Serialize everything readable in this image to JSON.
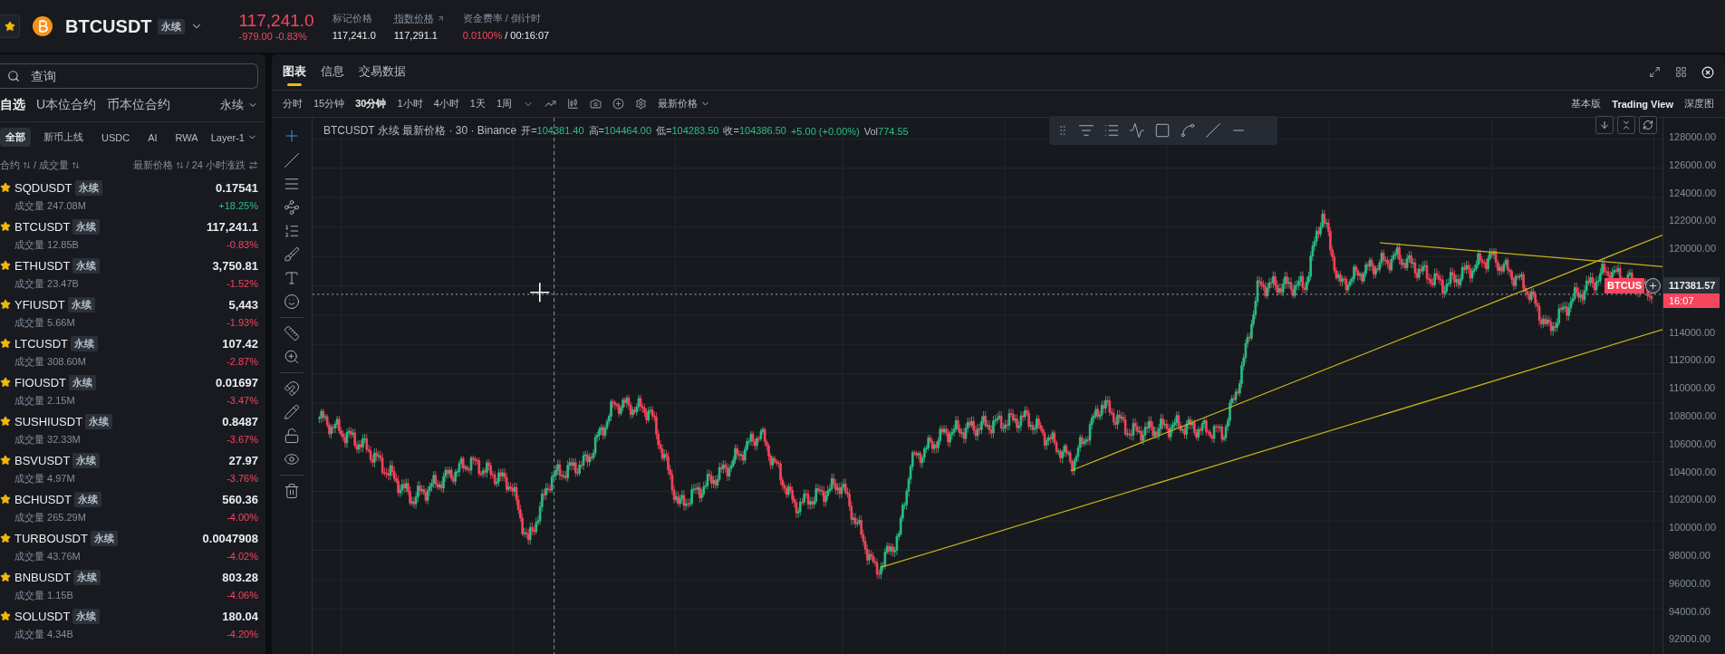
{
  "header": {
    "symbol": "BTCUSDT",
    "contract_tag": "永续",
    "starred": true,
    "price": "117,241.0",
    "change": "-979.00 -0.83%",
    "rising": false,
    "stats": [
      {
        "label": "标记价格",
        "value": "117,241.0",
        "link": false
      },
      {
        "label": "指数价格",
        "value": "117,291.1",
        "link": true
      }
    ],
    "funding": {
      "label": "资金费率 / 倒计时",
      "rate": "0.0100%",
      "countdown": "/ 00:16:07"
    }
  },
  "sidebar": {
    "search": {
      "placeholder": "查询"
    },
    "market_tabs": [
      {
        "label": "自选",
        "selected": true
      },
      {
        "label": "U本位合约",
        "selected": false
      },
      {
        "label": "币本位合约",
        "selected": false
      }
    ],
    "market_dropdown": "永续",
    "filters": [
      {
        "label": "全部",
        "selected": true
      },
      {
        "label": "新币上线",
        "selected": false
      },
      {
        "label": "USDC",
        "selected": false
      },
      {
        "label": "AI",
        "selected": false
      },
      {
        "label": "RWA",
        "selected": false
      }
    ],
    "filter_dropdown": "Layer-1",
    "columns": [
      {
        "label": "合约",
        "sub": "/ 成交量"
      },
      {
        "label": "最新价格",
        "sub": "/ 24 小时涨跌"
      }
    ],
    "rows": [
      {
        "symbol": "SQDUSDT",
        "tag": "永续",
        "starred": true,
        "price": "0.17541",
        "volume_label": "成交量",
        "volume": "247.08M",
        "change": "+18.25%",
        "rising": true
      },
      {
        "symbol": "BTCUSDT",
        "tag": "永续",
        "starred": true,
        "price": "117,241.1",
        "volume_label": "成交量",
        "volume": "12.85B",
        "change": "-0.83%",
        "rising": false
      },
      {
        "symbol": "ETHUSDT",
        "tag": "永续",
        "starred": true,
        "price": "3,750.81",
        "volume_label": "成交量",
        "volume": "23.47B",
        "change": "-1.52%",
        "rising": false
      },
      {
        "symbol": "YFIUSDT",
        "tag": "永续",
        "starred": true,
        "price": "5,443",
        "volume_label": "成交量",
        "volume": "5.66M",
        "change": "-1.93%",
        "rising": false
      },
      {
        "symbol": "LTCUSDT",
        "tag": "永续",
        "starred": true,
        "price": "107.42",
        "volume_label": "成交量",
        "volume": "308.60M",
        "change": "-2.87%",
        "rising": false
      },
      {
        "symbol": "FIOUSDT",
        "tag": "永续",
        "starred": true,
        "price": "0.01697",
        "volume_label": "成交量",
        "volume": "2.15M",
        "change": "-3.47%",
        "rising": false
      },
      {
        "symbol": "SUSHIUSDT",
        "tag": "永续",
        "starred": true,
        "price": "0.8487",
        "volume_label": "成交量",
        "volume": "32.33M",
        "change": "-3.67%",
        "rising": false
      },
      {
        "symbol": "BSVUSDT",
        "tag": "永续",
        "starred": true,
        "price": "27.97",
        "volume_label": "成交量",
        "volume": "4.97M",
        "change": "-3.76%",
        "rising": false
      },
      {
        "symbol": "BCHUSDT",
        "tag": "永续",
        "starred": true,
        "price": "560.36",
        "volume_label": "成交量",
        "volume": "265.29M",
        "change": "-4.00%",
        "rising": false
      },
      {
        "symbol": "TURBOUSDT",
        "tag": "永续",
        "starred": true,
        "price": "0.0047908",
        "volume_label": "成交量",
        "volume": "43.76M",
        "change": "-4.02%",
        "rising": false
      },
      {
        "symbol": "BNBUSDT",
        "tag": "永续",
        "starred": true,
        "price": "803.28",
        "volume_label": "成交量",
        "volume": "1.15B",
        "change": "-4.06%",
        "rising": false
      },
      {
        "symbol": "SOLUSDT",
        "tag": "永续",
        "starred": true,
        "price": "180.04",
        "volume_label": "成交量",
        "volume": "4.34B",
        "change": "-4.20%",
        "rising": false
      }
    ]
  },
  "chart_panel": {
    "tabs": [
      {
        "label": "图表",
        "selected": true
      },
      {
        "label": "信息",
        "selected": false
      },
      {
        "label": "交易数据",
        "selected": false
      }
    ],
    "intervals": [
      {
        "label": "分时",
        "selected": false
      },
      {
        "label": "15分钟",
        "selected": false
      },
      {
        "label": "30分钟",
        "selected": true
      },
      {
        "label": "1小时",
        "selected": false
      },
      {
        "label": "4小时",
        "selected": false
      },
      {
        "label": "1天",
        "selected": false
      },
      {
        "label": "1周",
        "selected": false
      }
    ],
    "price_type": "最新价格",
    "views": [
      {
        "label": "基本版",
        "selected": false
      },
      {
        "label": "Trading View",
        "selected": true
      },
      {
        "label": "深度图",
        "selected": false
      }
    ],
    "legend": {
      "title": "BTCUSDT 永续 最新价格 · 30 · Binance",
      "ohlc": [
        {
          "label": "开=",
          "value": "104381.40"
        },
        {
          "label": "高=",
          "value": "104464.00"
        },
        {
          "label": "低=",
          "value": "104283.50"
        },
        {
          "label": "收=",
          "value": "104386.50"
        }
      ],
      "change": "+5.00 (+0.00%)",
      "volume_label": "Vol",
      "volume": "774.55"
    },
    "price_axis": [
      "128000.00",
      "126000.00",
      "124000.00",
      "122000.00",
      "120000.00",
      "114000.00",
      "112000.00",
      "110000.00",
      "108000.00",
      "106000.00",
      "104000.00",
      "102000.00",
      "100000.00",
      "98000.00",
      "96000.00",
      "94000.00",
      "92000.00"
    ],
    "symbol_tag": "BTCUS",
    "last_price": "117381.57",
    "countdown": "16:07"
  }
}
